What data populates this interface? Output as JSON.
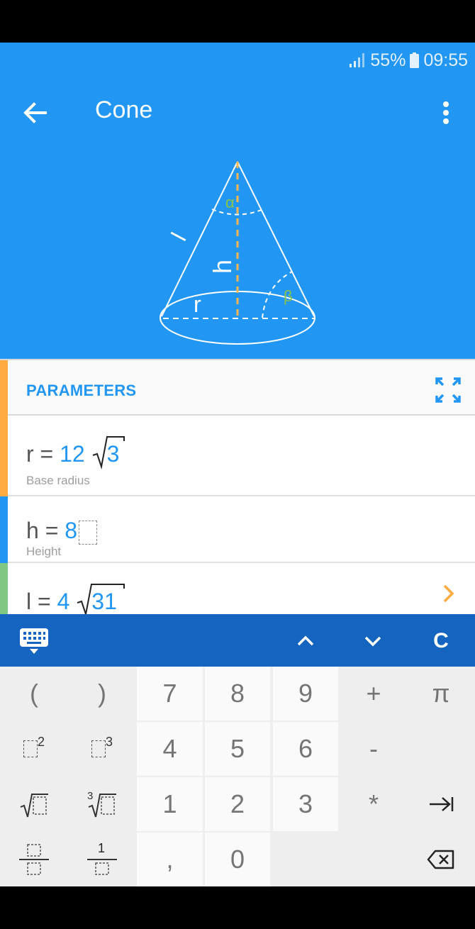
{
  "status": {
    "battery": "55%",
    "time": "09:55"
  },
  "appbar": {
    "title": "Cone"
  },
  "diagram": {
    "labels": {
      "alpha": "α",
      "beta": "β",
      "h": "h",
      "r": "r",
      "l": "l"
    }
  },
  "parameters": {
    "title": "PARAMETERS",
    "rows": [
      {
        "var": "r",
        "eq": "=",
        "coef": "12",
        "radicand": "3",
        "label": "Base radius",
        "color": "#ffab40"
      },
      {
        "var": "h",
        "eq": "=",
        "value": "8",
        "label": "Height",
        "color": "#2196f3"
      },
      {
        "var": "l",
        "eq": "=",
        "coef": "4",
        "radicand": "31",
        "label": "",
        "color": "#81c784"
      }
    ]
  },
  "keyboard": {
    "clear_label": "C",
    "keys": {
      "lparen": "(",
      "rparen": ")",
      "k7": "7",
      "k8": "8",
      "k9": "9",
      "plus": "+",
      "pi": "π",
      "k4": "4",
      "k5": "5",
      "k6": "6",
      "minus": "-",
      "k1": "1",
      "k2": "2",
      "k3": "3",
      "times": "*",
      "comma": ",",
      "k0": "0",
      "sq_exp": "2",
      "cube_exp": "3",
      "cbrt_index": "3",
      "frac_one": "1"
    }
  },
  "colors": {
    "primary": "#2196f3",
    "dark": "#1565c0",
    "accent": "#ffab40",
    "diagram_dash": "#ffb74d",
    "greek": "#8bc34a"
  }
}
